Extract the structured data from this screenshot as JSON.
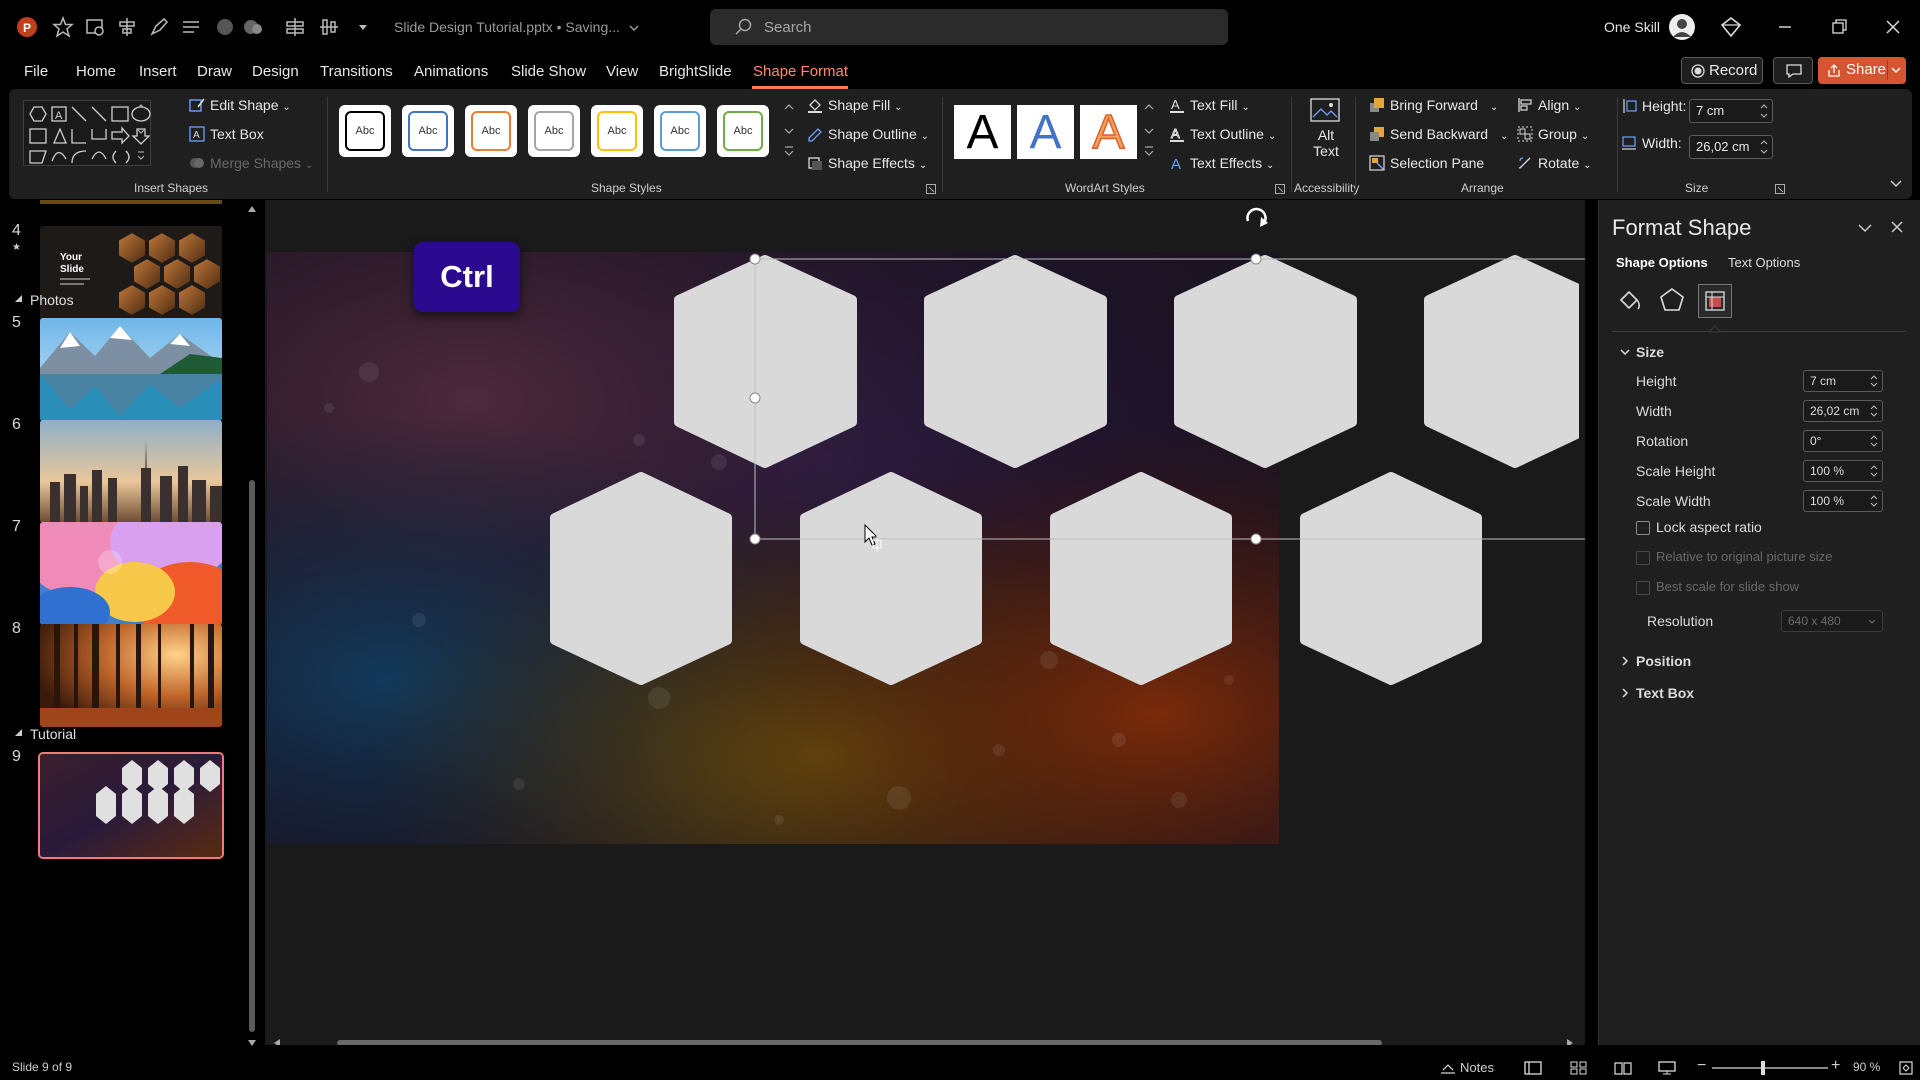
{
  "window": {
    "title": "Slide Design Tutorial.pptx • Saving...",
    "search_placeholder": "Search",
    "user_name": "One Skill"
  },
  "menu": {
    "items": [
      "File",
      "Home",
      "Insert",
      "Draw",
      "Design",
      "Transitions",
      "Animations",
      "Slide Show",
      "View",
      "BrightSlide",
      "Shape Format"
    ],
    "active": "Shape Format",
    "record_label": "Record",
    "share_label": "Share"
  },
  "ribbon": {
    "insert_shapes": {
      "label": "Insert Shapes",
      "edit_shape": "Edit Shape",
      "text_box": "Text Box",
      "merge_shapes": "Merge Shapes"
    },
    "shape_styles": {
      "label": "Shape Styles",
      "swatch_text": "Abc",
      "swatch_colors": [
        "#000000",
        "#4472c4",
        "#ed7d31",
        "#a5a5a5",
        "#ffc000",
        "#5b9bd5",
        "#70ad47"
      ],
      "shape_fill": "Shape Fill",
      "shape_outline": "Shape Outline",
      "shape_effects": "Shape Effects"
    },
    "wordart": {
      "label": "WordArt Styles",
      "letter": "A",
      "text_fill": "Text Fill",
      "text_outline": "Text Outline",
      "text_effects": "Text Effects"
    },
    "accessibility": {
      "label": "Accessibility",
      "alt_text_line1": "Alt",
      "alt_text_line2": "Text"
    },
    "arrange": {
      "label": "Arrange",
      "bring_forward": "Bring Forward",
      "send_backward": "Send Backward",
      "selection_pane": "Selection Pane",
      "align": "Align",
      "group": "Group",
      "rotate": "Rotate"
    },
    "size": {
      "label": "Size",
      "height_label": "Height:",
      "height_value": "7 cm",
      "width_label": "Width:",
      "width_value": "26,02 cm"
    }
  },
  "thumbnails": {
    "slide4_num": "4",
    "slide4_text": "Your Slide",
    "section_photos": "Photos",
    "slide5_num": "5",
    "slide6_num": "6",
    "slide7_num": "7",
    "slide8_num": "8",
    "section_tutorial": "Tutorial",
    "slide9_num": "9"
  },
  "canvas": {
    "key_badge": "Ctrl"
  },
  "format_pane": {
    "title": "Format Shape",
    "tab_shape_options": "Shape Options",
    "tab_text_options": "Text Options",
    "section_size": "Size",
    "height_label": "Height",
    "height_value": "7 cm",
    "width_label": "Width",
    "width_value": "26,02 cm",
    "rotation_label": "Rotation",
    "rotation_value": "0°",
    "scale_height_label": "Scale Height",
    "scale_height_value": "100 %",
    "scale_width_label": "Scale Width",
    "scale_width_value": "100 %",
    "lock_aspect": "Lock aspect ratio",
    "relative_original": "Relative to original picture size",
    "best_scale": "Best scale for slide show",
    "resolution_label": "Resolution",
    "resolution_value": "640 x 480",
    "section_position": "Position",
    "section_text_box": "Text Box"
  },
  "status": {
    "slide_info": "Slide 9 of 9",
    "notes": "Notes",
    "zoom": "90 %"
  },
  "colors": {
    "accent": "#ff7b5a",
    "share": "#d4552f",
    "ctrl_badge": "#2b0a8f",
    "hexagon": "#d9d9d9"
  }
}
